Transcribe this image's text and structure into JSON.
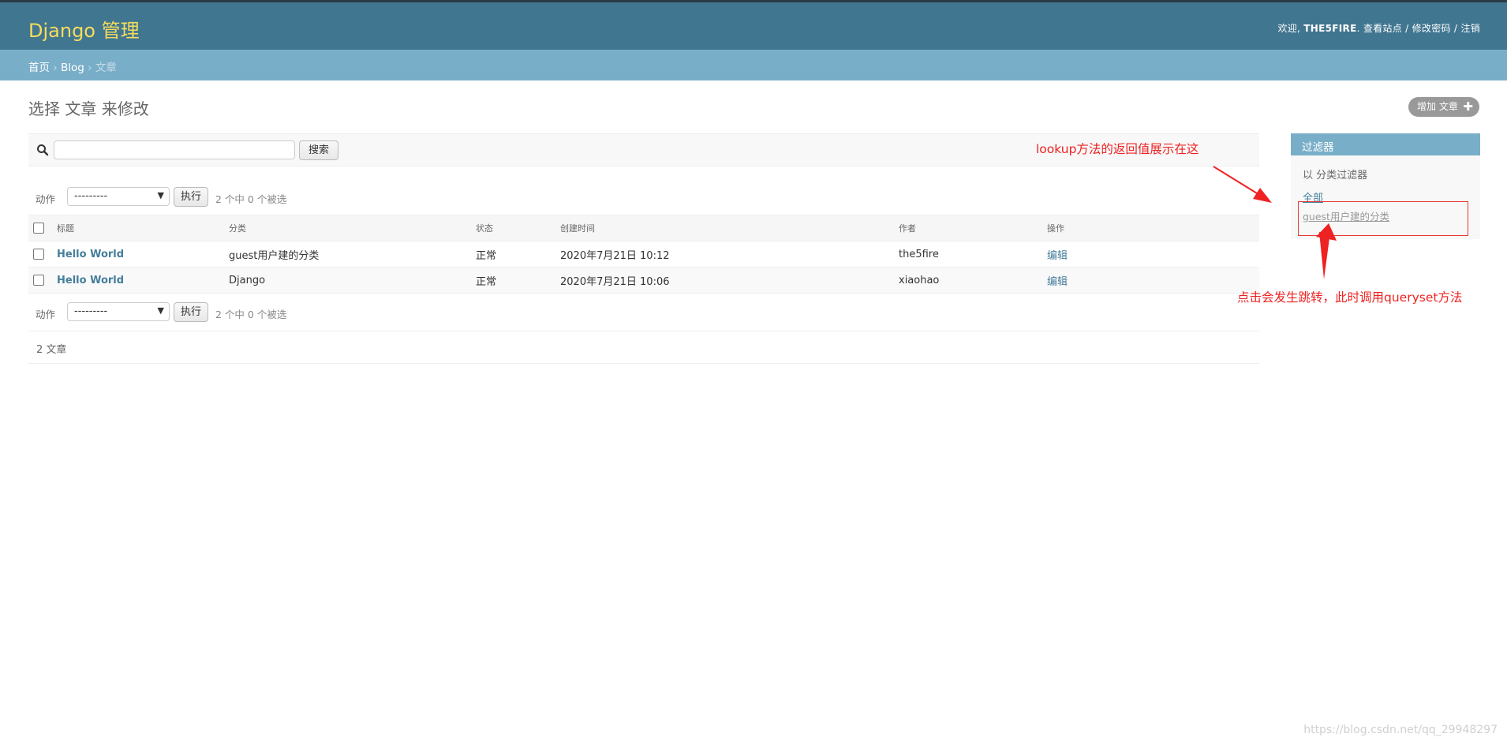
{
  "header": {
    "brand": "Django 管理",
    "welcome": "欢迎,",
    "username": "THE5FIRE",
    "separator": ".",
    "view_site": "查看站点",
    "change_password": "修改密码",
    "logout": "注销"
  },
  "breadcrumbs": {
    "home": "首页",
    "app": "Blog",
    "current": "文章"
  },
  "page_title": "选择 文章 来修改",
  "add_button": {
    "label": "增加 文章",
    "icon": "plus-icon"
  },
  "search": {
    "value": "",
    "button": "搜索",
    "icon": "search-icon"
  },
  "actions": {
    "label": "动作",
    "selected_option": "---------",
    "go": "执行",
    "counter": "2 个中 0 个被选"
  },
  "table": {
    "columns": [
      "标题",
      "分类",
      "状态",
      "创建时间",
      "作者",
      "操作"
    ],
    "rows": [
      {
        "title": "Hello World",
        "category": "guest用户建的分类",
        "status": "正常",
        "created": "2020年7月21日 10:12",
        "author": "the5fire",
        "op": "编辑"
      },
      {
        "title": "Hello World",
        "category": "Django",
        "status": "正常",
        "created": "2020年7月21日 10:06",
        "author": "xiaohao",
        "op": "编辑"
      }
    ]
  },
  "paginator": "2 文章",
  "filter": {
    "title": "过滤器",
    "subtitle": "以 分类过滤器",
    "options": [
      "全部",
      "guest用户建的分类"
    ]
  },
  "annotations": {
    "lookup_note": "lookup方法的返回值展示在这",
    "click_note": "点击会发生跳转，此时调用queryset方法",
    "color": "#ee2222"
  },
  "watermark": "https://blog.csdn.net/qq_29948297",
  "colors": {
    "header": "#417690",
    "brand": "#f5dd5d",
    "breadcrumbs": "#79aec8",
    "link": "#447e9b"
  }
}
